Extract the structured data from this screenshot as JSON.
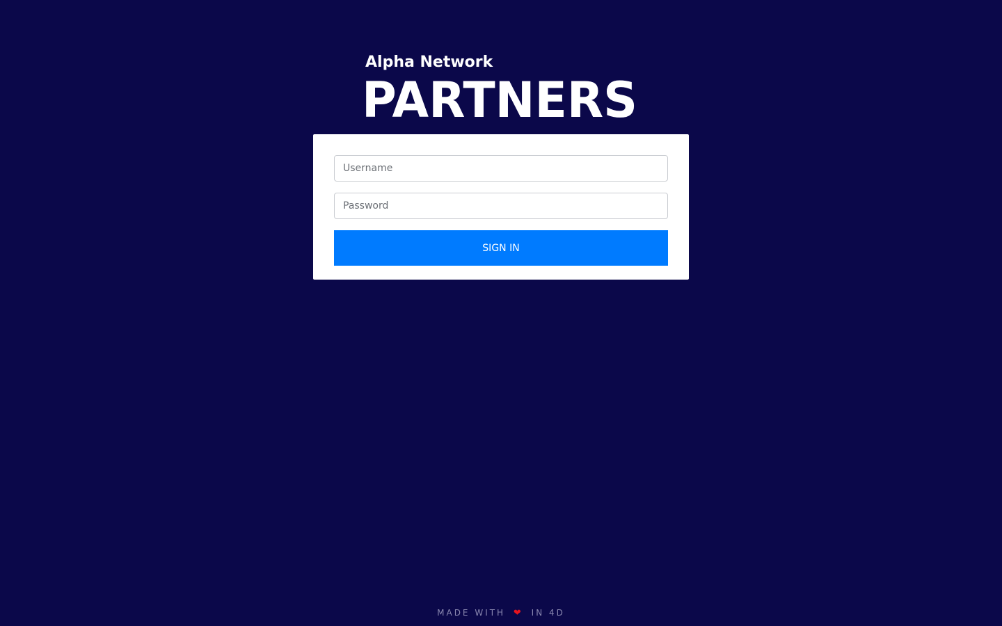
{
  "brand": {
    "subtitle": "Alpha Network",
    "title": "PARTNERS"
  },
  "login": {
    "username_placeholder": "Username",
    "username_value": "",
    "password_placeholder": "Password",
    "password_value": "",
    "submit_label": "SIGN IN"
  },
  "footer": {
    "prefix": "MADE WITH",
    "suffix": "IN 4D",
    "heart_icon": "heart-icon"
  },
  "colors": {
    "background": "#0b084a",
    "accent": "#007bff",
    "heart": "#e8141e"
  }
}
